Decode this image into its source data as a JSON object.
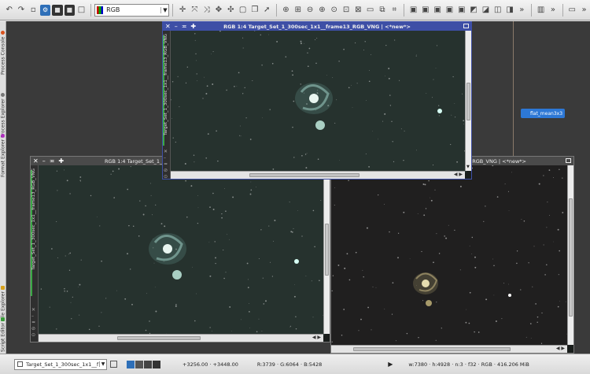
{
  "toolbar": {
    "channel_select": "RGB"
  },
  "sidebar_tabs": [
    {
      "label": "Process Console",
      "color": "#d9531e"
    },
    {
      "label": "Process Explorer",
      "color": "#555555"
    },
    {
      "label": "Format Explorer",
      "color": "#b02fc0"
    },
    {
      "label": "File Explorer",
      "color": "#d8a21c"
    },
    {
      "label": "Script Editor",
      "color": "#3a9a3a"
    }
  ],
  "icon_tag": {
    "label": "flat_mean3x3"
  },
  "windows": {
    "top": {
      "title": "RGB 1:4 Target_Set_1_300sec_1x1__frame13_RGB_VNG | <*new*>",
      "vertical_id": "Target_Set_1_300sec_1x1__frame13_RGB_VNG",
      "active": true
    },
    "left": {
      "title": "RGB 1:4 Target_Set_1_3",
      "vertical_id": "Target_Set_1_300sec_1x1__frame13_RGB_VNG"
    },
    "right": {
      "title": "_RGB_VNG | <*new*>"
    }
  },
  "statusbar": {
    "view_name": "Target_Set_1_300sec_1x1__f",
    "coords": "+3256.00 · +3448.00",
    "pixel_values": "R:3739 · G:6064 · B:5428",
    "image_info": "w:7380 · h:4928 · n:3 · f32 · RGB · 416.206 MiB"
  },
  "colors": {
    "active_title": "#3e4fa6",
    "sky_top": "#26322e",
    "sky_right": "#201f1f"
  }
}
